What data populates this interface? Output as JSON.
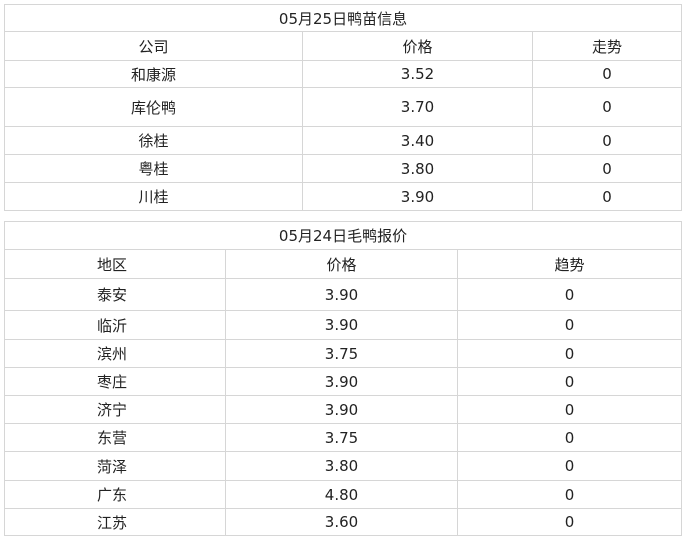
{
  "duckling": {
    "title": "05月25日鸭苗信息",
    "headers": [
      "公司",
      "价格",
      "走势"
    ],
    "rows": [
      [
        "和康源",
        "3.52",
        "0"
      ],
      [
        "库伦鸭",
        "3.70",
        "0"
      ],
      [
        "徐桂",
        "3.40",
        "0"
      ],
      [
        "粤桂",
        "3.80",
        "0"
      ],
      [
        "川桂",
        "3.90",
        "0"
      ]
    ]
  },
  "hairy_duck": {
    "title": "05月24日毛鸭报价",
    "headers": [
      "地区",
      "价格",
      "趋势"
    ],
    "rows": [
      [
        "泰安",
        "3.90",
        "0"
      ],
      [
        "临沂",
        "3.90",
        "0"
      ],
      [
        "滨州",
        "3.75",
        "0"
      ],
      [
        "枣庄",
        "3.90",
        "0"
      ],
      [
        "济宁",
        "3.90",
        "0"
      ],
      [
        "东营",
        "3.75",
        "0"
      ],
      [
        "菏泽",
        "3.80",
        "0"
      ],
      [
        "广东",
        "4.80",
        "0"
      ],
      [
        "江苏",
        "3.60",
        "0"
      ]
    ]
  }
}
